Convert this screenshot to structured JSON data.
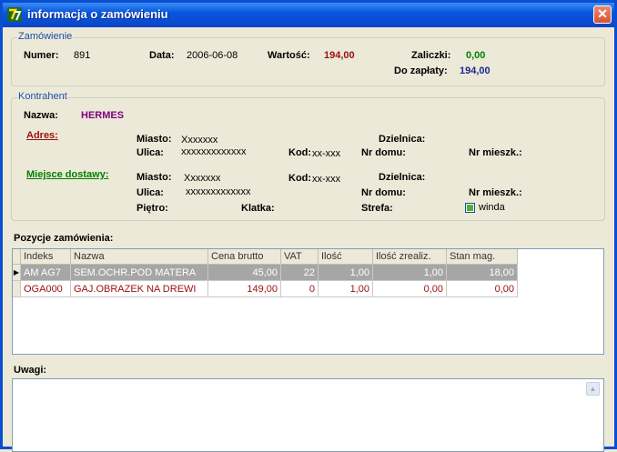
{
  "window": {
    "title": "informacja o zamówieniu",
    "close_label": "✕"
  },
  "order": {
    "legend": "Zamówienie",
    "number_label": "Numer:",
    "number_value": "891",
    "date_label": "Data:",
    "date_value": "2006-06-08",
    "value_label": "Wartość:",
    "value_value": "194,00",
    "advance_label": "Zaliczki:",
    "advance_value": "0,00",
    "to_pay_label": "Do zapłaty:",
    "to_pay_value": "194,00"
  },
  "contractor": {
    "legend": "Kontrahent",
    "name_label": "Nazwa:",
    "name_value": "HERMES",
    "address": {
      "link": "Adres:",
      "city_label": "Miasto:",
      "city_value": "Xxxxxxx",
      "district_label": "Dzielnica:",
      "street_label": "Ulica:",
      "street_value": "xxxxxxxxxxxxx",
      "postcode_label": "Kod:",
      "postcode_value": "xx-xxx",
      "house_label": "Nr domu:",
      "flat_label": "Nr mieszk.:"
    },
    "delivery": {
      "link": "Miejsce dostawy:",
      "city_label": "Miasto:",
      "city_value": "Xxxxxxx",
      "district_label": "Dzielnica:",
      "street_label": "Ulica:",
      "street_value": "xxxxxxxxxxxxx",
      "postcode_label": "Kod:",
      "postcode_value": "xx-xxx",
      "house_label": "Nr domu:",
      "flat_label": "Nr mieszk.:",
      "floor_label": "Piętro:",
      "staircase_label": "Klatka:",
      "zone_label": "Strefa:",
      "elevator_label": "winda"
    }
  },
  "items": {
    "heading": "Pozycje zamówienia:",
    "columns": [
      "Indeks",
      "Nazwa",
      "Cena brutto",
      "VAT",
      "Ilość",
      "Ilość zrealiz.",
      "Stan mag."
    ],
    "rows": [
      {
        "index": "AM AG7",
        "name": "SEM.OCHR.POD MATERA",
        "price": "45,00",
        "vat": "22",
        "qty": "1,00",
        "qty_done": "1,00",
        "stock": "18,00"
      },
      {
        "index": "OGA000",
        "name": "GAJ.OBRAZEK NA DREWI",
        "price": "149,00",
        "vat": "0",
        "qty": "1,00",
        "qty_done": "0,00",
        "stock": "0,00"
      }
    ],
    "row_indicator": "▶"
  },
  "notes": {
    "label": "Uwagi:",
    "value": ""
  },
  "scroll": {
    "up_glyph": "▲"
  }
}
